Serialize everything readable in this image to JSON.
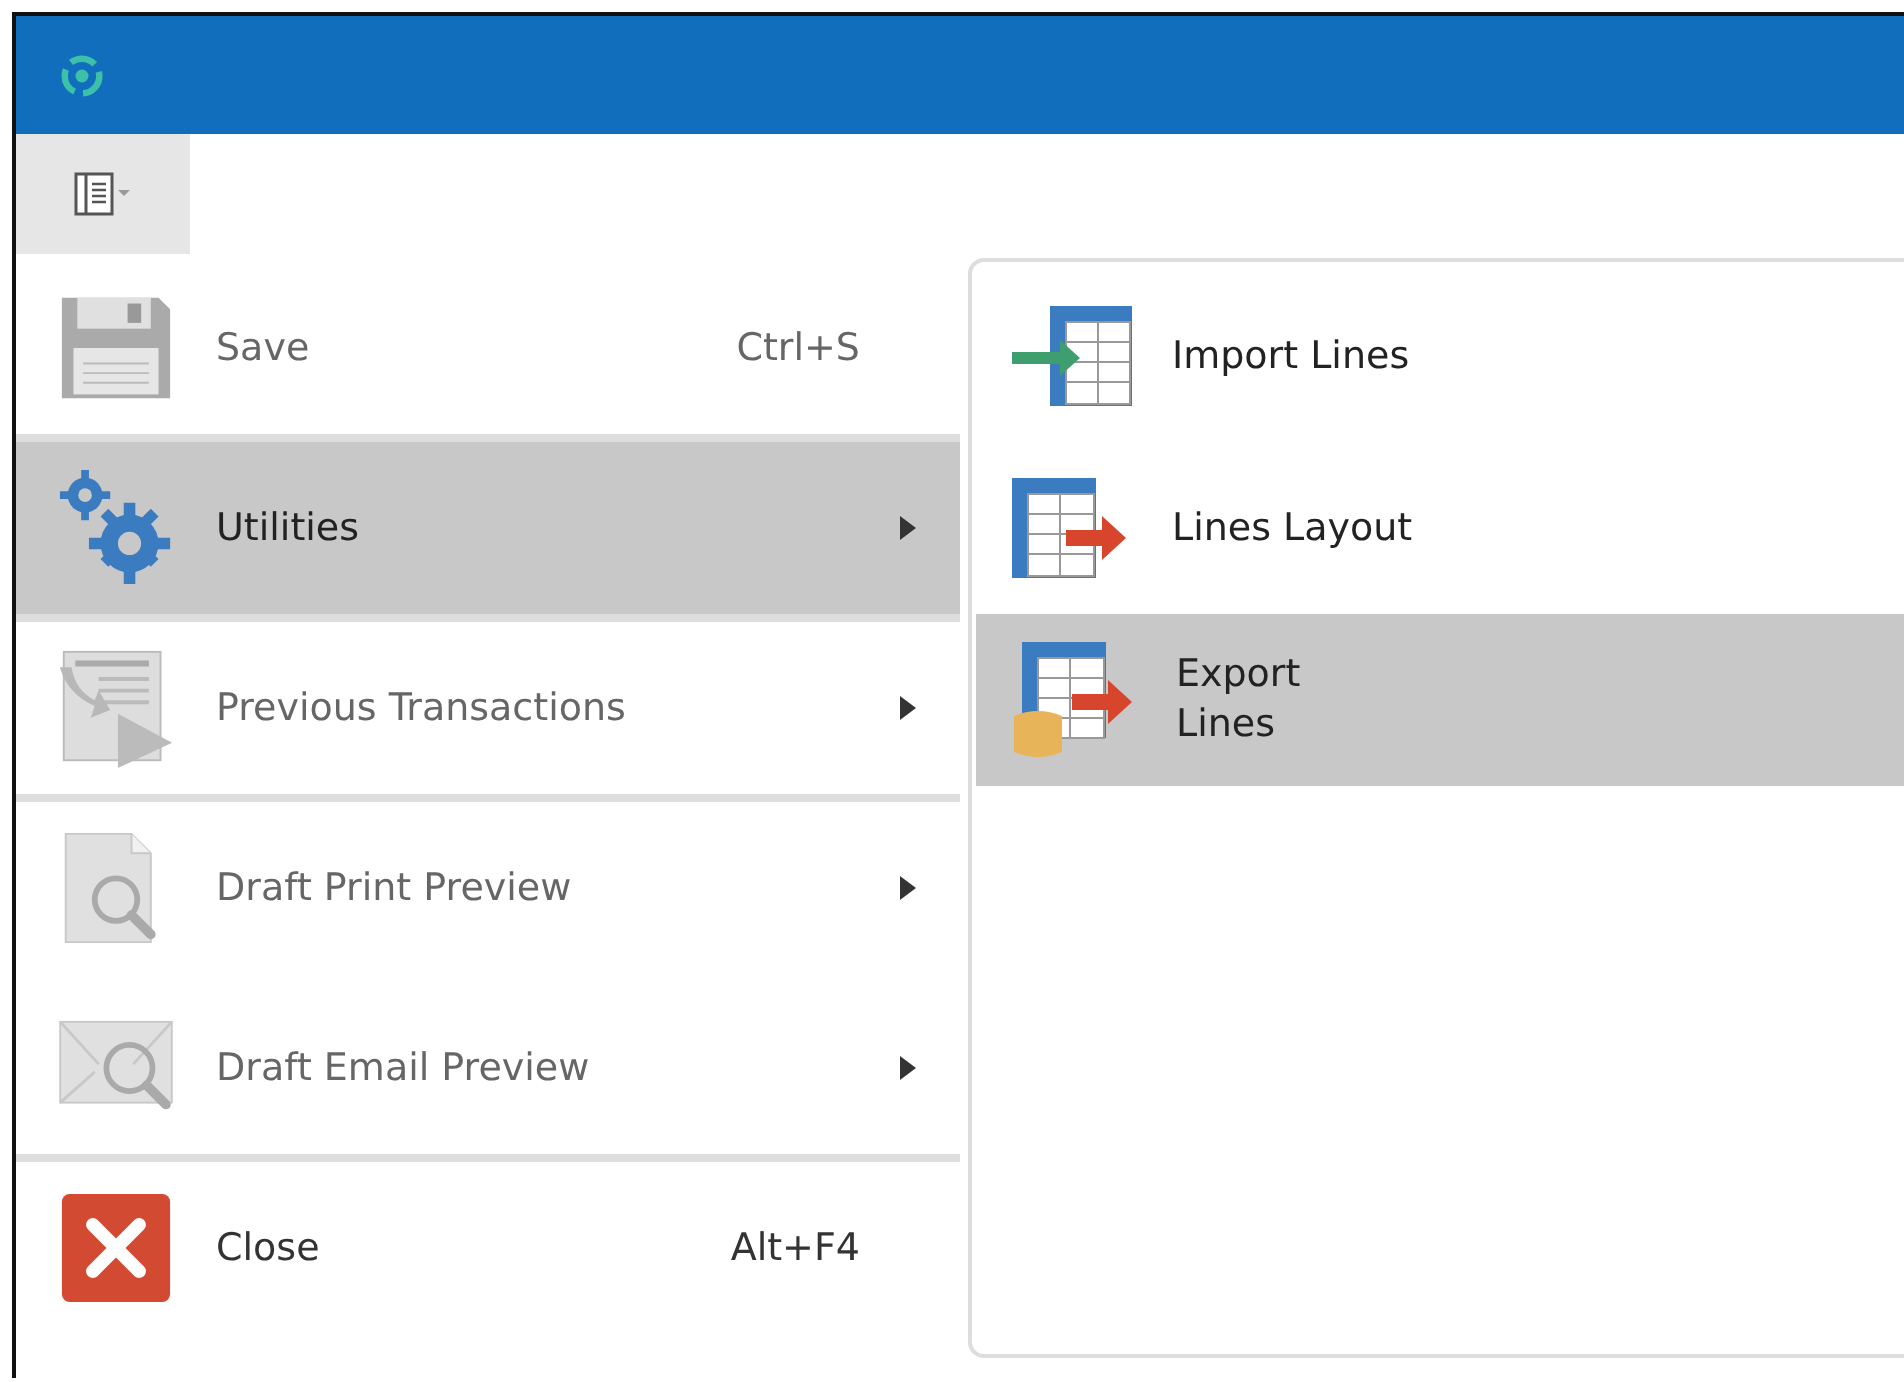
{
  "menu": {
    "items": [
      {
        "label": "Save",
        "shortcut": "Ctrl+S",
        "has_submenu": false,
        "selected": false,
        "disabled": true,
        "divider_before": false
      },
      {
        "label": "Utilities",
        "has_submenu": true,
        "selected": true,
        "disabled": false,
        "divider_before": true
      },
      {
        "label": "Previous Transactions",
        "has_submenu": true,
        "selected": false,
        "disabled": true,
        "divider_before": true
      },
      {
        "label": "Draft Print Preview",
        "has_submenu": true,
        "selected": false,
        "disabled": true,
        "divider_before": true
      },
      {
        "label": "Draft Email Preview",
        "has_submenu": true,
        "selected": false,
        "disabled": true,
        "divider_before": false
      },
      {
        "label": "Close",
        "shortcut": "Alt+F4",
        "has_submenu": false,
        "selected": false,
        "disabled": false,
        "divider_before": true
      }
    ]
  },
  "submenu": {
    "items": [
      {
        "label": "Import Lines",
        "selected": false
      },
      {
        "label": "Lines Layout",
        "selected": false
      },
      {
        "label": "Export\nLines",
        "selected": true
      }
    ]
  }
}
